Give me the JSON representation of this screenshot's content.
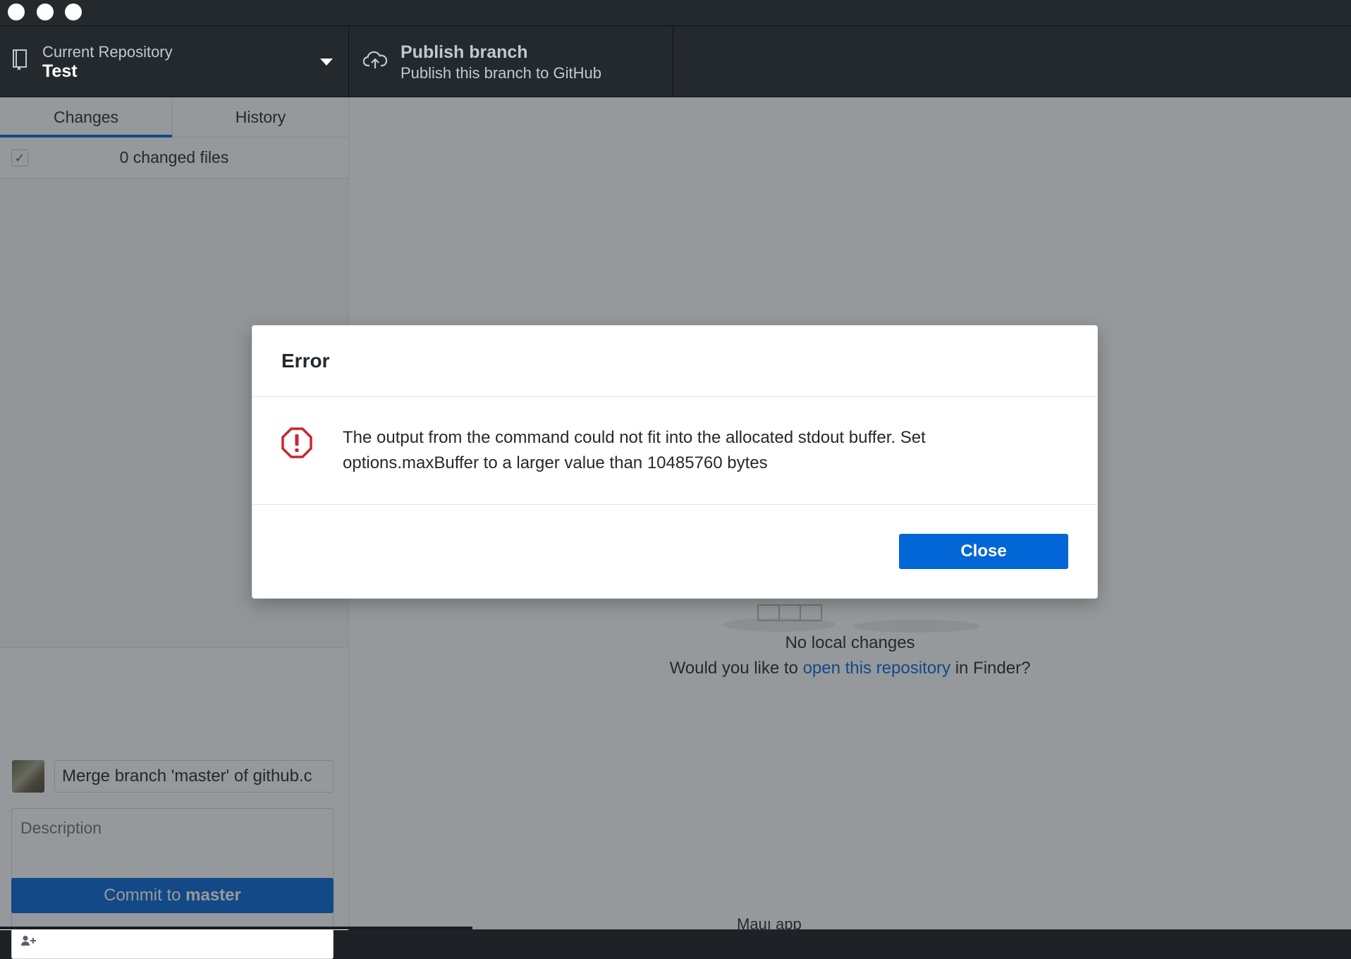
{
  "window": {
    "traffic_lights": [
      "close",
      "minimize",
      "zoom"
    ]
  },
  "toolbar": {
    "repository": {
      "label": "Current Repository",
      "value": "Test",
      "icon": "repo-icon"
    },
    "publish": {
      "label": "Publish branch",
      "subtitle": "Publish this branch to GitHub",
      "icon": "cloud-upload-icon"
    }
  },
  "sidebar": {
    "tabs": [
      {
        "label": "Changes",
        "active": true
      },
      {
        "label": "History",
        "active": false
      }
    ],
    "changes_summary": "0 changed files",
    "check_mark": "✓"
  },
  "commit": {
    "summary_value": "Merge branch 'master' of github.c",
    "description_placeholder": "Description",
    "coauthor_icon": "add-coauthor-icon",
    "button_prefix": "Commit to ",
    "button_branch": "master"
  },
  "main": {
    "no_changes_title": "No local changes",
    "prompt_prefix": "Would you like to ",
    "prompt_link": "open this repository",
    "prompt_suffix": " in Finder?",
    "footer_fragment": "Mauı app"
  },
  "dialog": {
    "title": "Error",
    "message": "The output from the command could not fit into the allocated stdout buffer. Set options.maxBuffer to a larger value than 10485760 bytes",
    "close_label": "Close",
    "icon": "error-icon"
  },
  "colors": {
    "accent": "#0366d6",
    "error": "#cb2431",
    "toolbar_bg": "#24292e"
  }
}
